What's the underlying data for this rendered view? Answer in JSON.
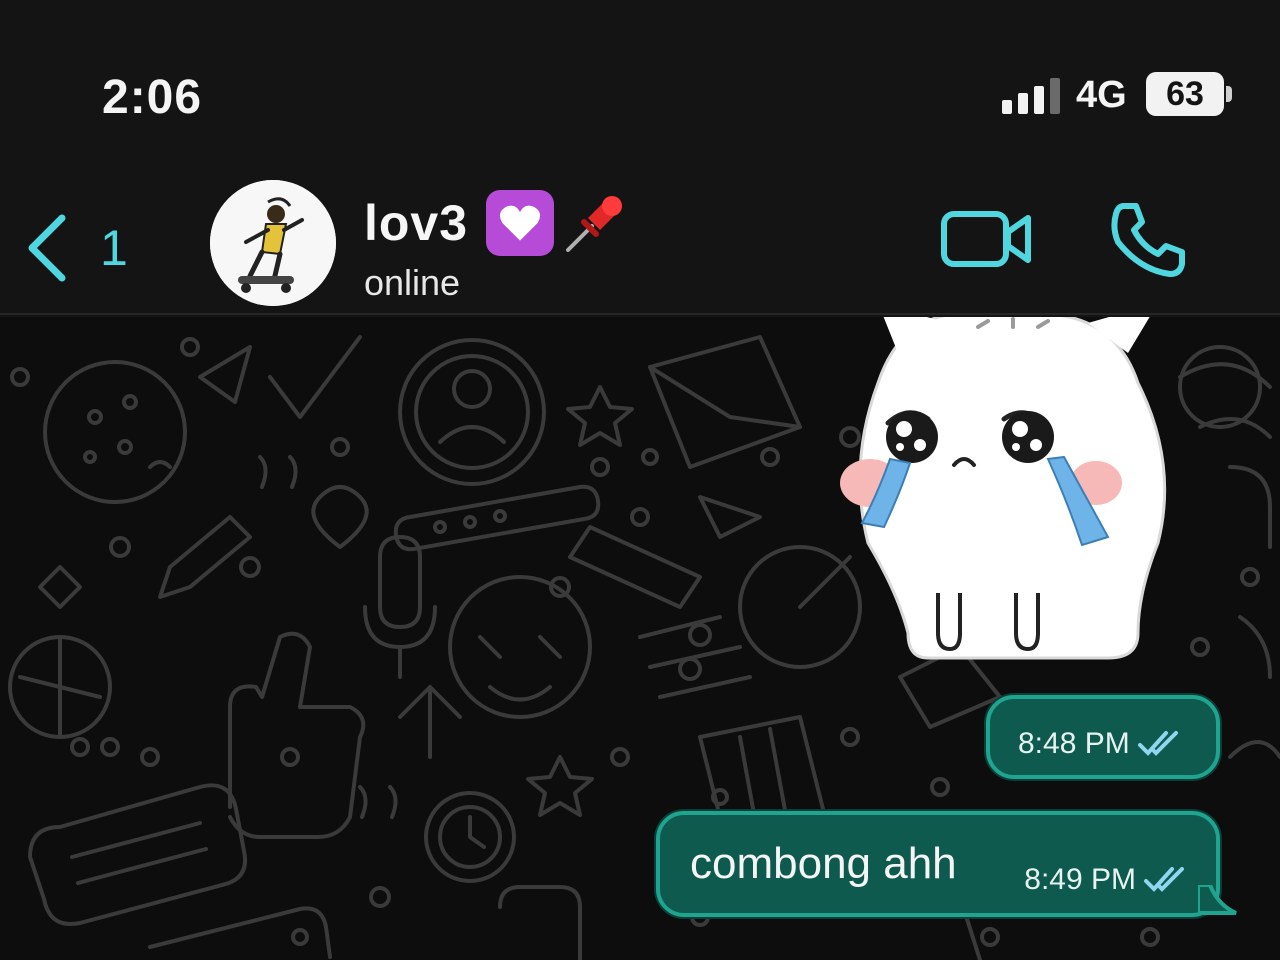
{
  "status_bar": {
    "time": "2:06",
    "network": "4G",
    "battery": "63"
  },
  "header": {
    "back_count": "1",
    "contact_name": "lov3",
    "contact_status": "online",
    "name_emojis": [
      "purple-heart",
      "pushpin"
    ]
  },
  "messages": [
    {
      "type": "sticker",
      "sticker": "crying-white-cat"
    },
    {
      "type": "outgoing",
      "text": "",
      "time": "8:48 PM",
      "status": "read"
    },
    {
      "type": "outgoing",
      "text": "combong ahh",
      "time": "8:49 PM",
      "status": "read"
    }
  ],
  "colors": {
    "accent": "#4fd6df",
    "bubble_fill": "#0f5a4f",
    "bubble_border": "#1fa58f",
    "background": "#141414"
  },
  "icons": [
    "back-chevron-icon",
    "video-call-icon",
    "phone-icon",
    "signal-icon",
    "battery-icon",
    "read-ticks-icon"
  ]
}
